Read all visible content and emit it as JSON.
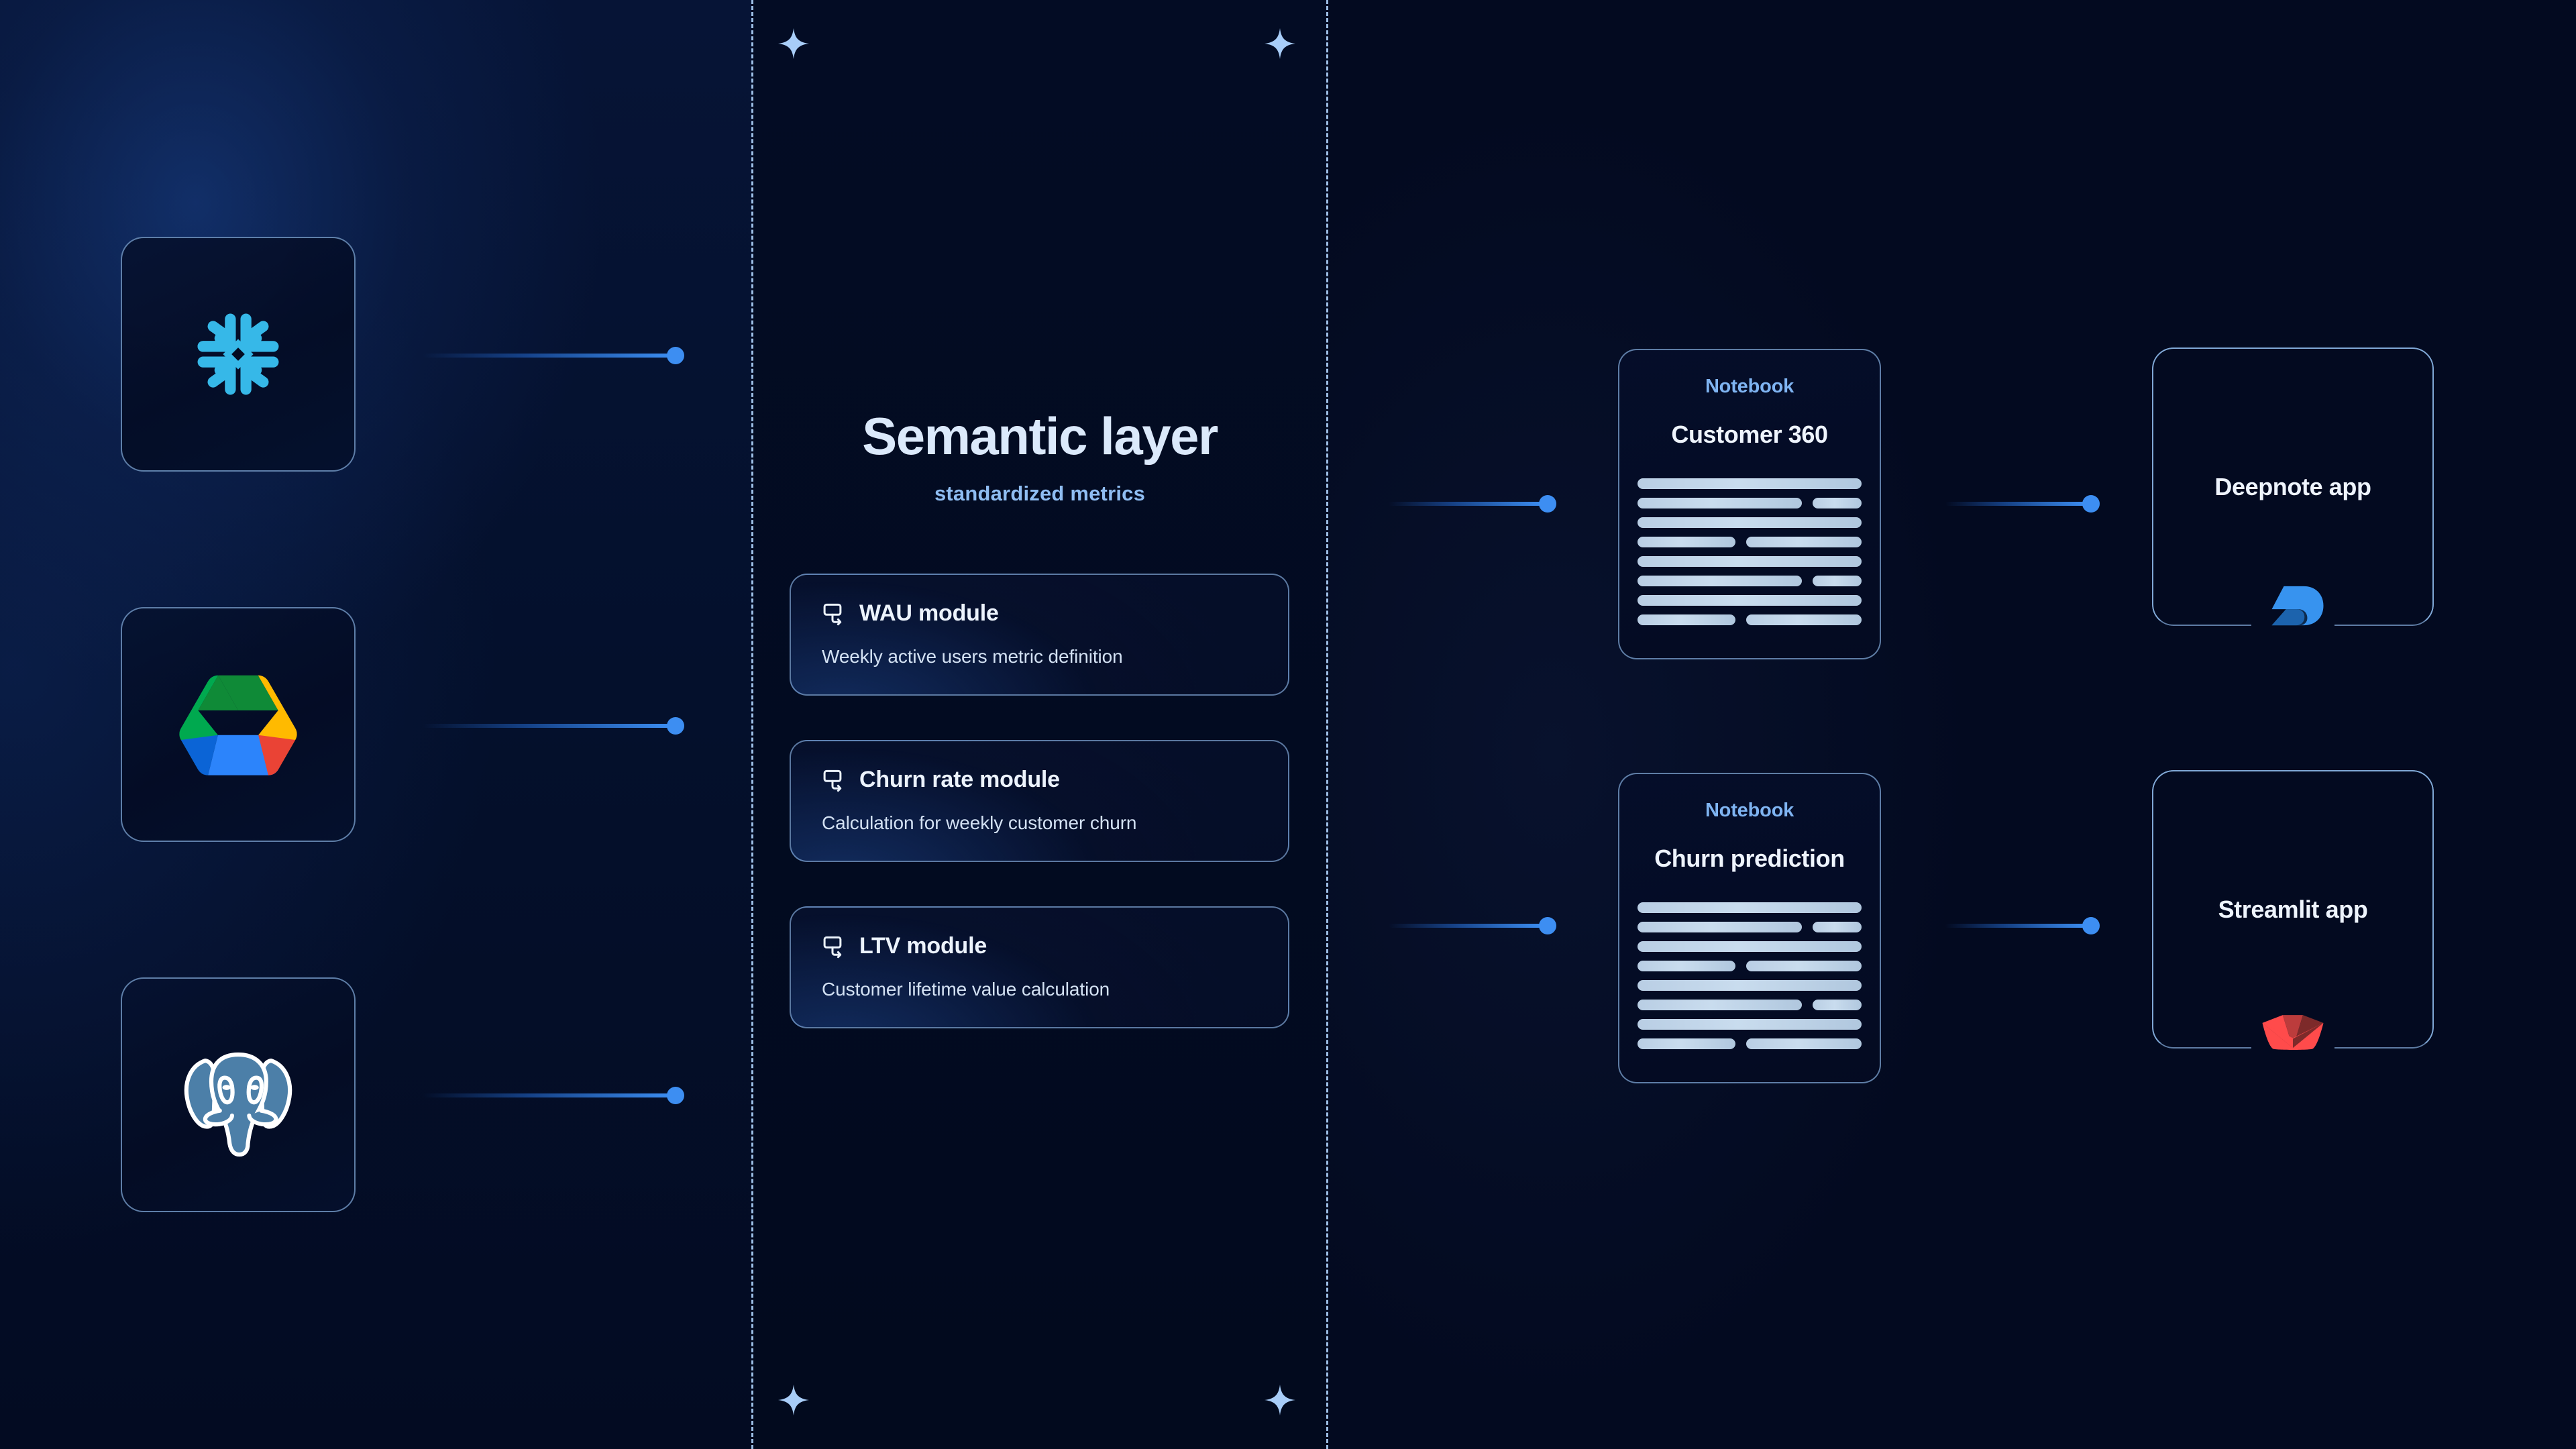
{
  "theme": {
    "background": "#030b22",
    "accent_blue": "#3d8ef2",
    "border_blue": "#96c4f6",
    "text_primary": "#eef4fd",
    "text_muted": "#d3e1f3",
    "kicker_blue": "#7fb4f2",
    "snowflake_blue": "#36b8e8",
    "postgres_blue": "#4c7fa8",
    "streamlit_red": "#ff4b4b",
    "deepnote_blue": "#3793ef"
  },
  "sources": [
    {
      "name": "Snowflake",
      "icon": "snowflake-logo"
    },
    {
      "name": "Google Drive",
      "icon": "google-drive-logo"
    },
    {
      "name": "PostgreSQL",
      "icon": "postgresql-logo"
    }
  ],
  "semantic_layer": {
    "title": "Semantic layer",
    "subtitle": "standardized  metrics",
    "modules": [
      {
        "icon": "monitor-arrow-icon",
        "title": "WAU module",
        "description": "Weekly active users metric definition"
      },
      {
        "icon": "monitor-arrow-icon",
        "title": "Churn rate module",
        "description": "Calculation for weekly customer churn"
      },
      {
        "icon": "monitor-arrow-icon",
        "title": "LTV module",
        "description": "Customer lifetime value calculation"
      }
    ]
  },
  "notebooks": [
    {
      "kicker": "Notebook",
      "title": "Customer 360",
      "placeholder_rows": [
        [
          100
        ],
        [
          74,
          22
        ],
        [
          100
        ],
        [
          44,
          52
        ],
        [
          100
        ],
        [
          74,
          22
        ],
        [
          100
        ],
        [
          44,
          52
        ]
      ]
    },
    {
      "kicker": "Notebook",
      "title": "Churn prediction",
      "placeholder_rows": [
        [
          100
        ],
        [
          74,
          22
        ],
        [
          100
        ],
        [
          44,
          52
        ],
        [
          100
        ],
        [
          74,
          22
        ],
        [
          100
        ],
        [
          44,
          52
        ]
      ]
    }
  ],
  "apps": [
    {
      "label": "Deepnote app",
      "logo": "deepnote-logo"
    },
    {
      "label": "Streamlit app",
      "logo": "streamlit-logo"
    }
  ],
  "decorations": {
    "sparkle_count": 4,
    "sparkle_icon": "four-point-star-icon",
    "divider_style": "dashed"
  }
}
